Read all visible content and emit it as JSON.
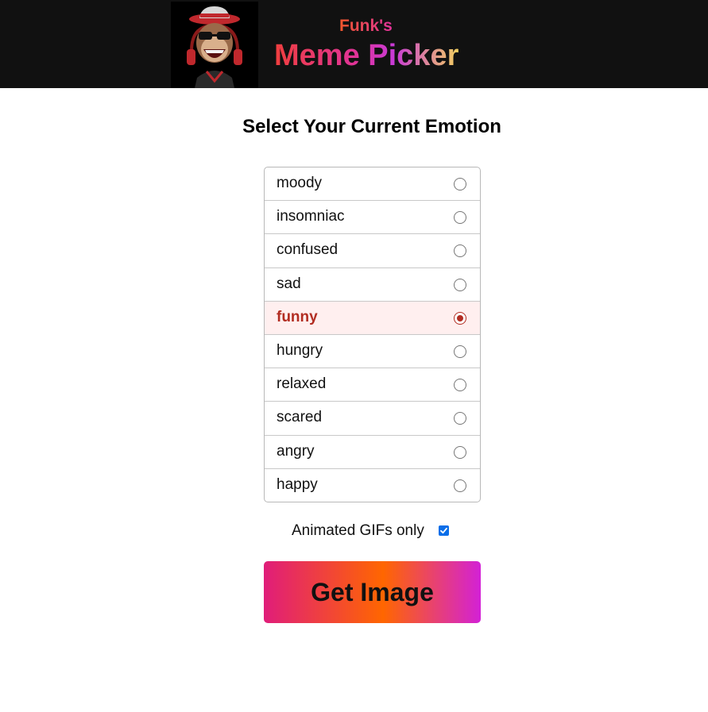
{
  "header": {
    "subtitle": "Funk's",
    "title": "Meme Picker",
    "logo_icon": "monkey-dj-logo-icon"
  },
  "main": {
    "heading": "Select Your Current Emotion",
    "emotions": [
      {
        "label": "moody",
        "selected": false
      },
      {
        "label": "insomniac",
        "selected": false
      },
      {
        "label": "confused",
        "selected": false
      },
      {
        "label": "sad",
        "selected": false
      },
      {
        "label": "funny",
        "selected": true
      },
      {
        "label": "hungry",
        "selected": false
      },
      {
        "label": "relaxed",
        "selected": false
      },
      {
        "label": "scared",
        "selected": false
      },
      {
        "label": "angry",
        "selected": false
      },
      {
        "label": "happy",
        "selected": false
      }
    ],
    "gif_option": {
      "label": "Animated GIFs only",
      "checked": true
    },
    "button_label": "Get Image"
  },
  "colors": {
    "header_bg": "#111111",
    "selected_bg": "#ffefef",
    "selected_text": "#b22d22",
    "checkbox": "#0a6ee8"
  }
}
